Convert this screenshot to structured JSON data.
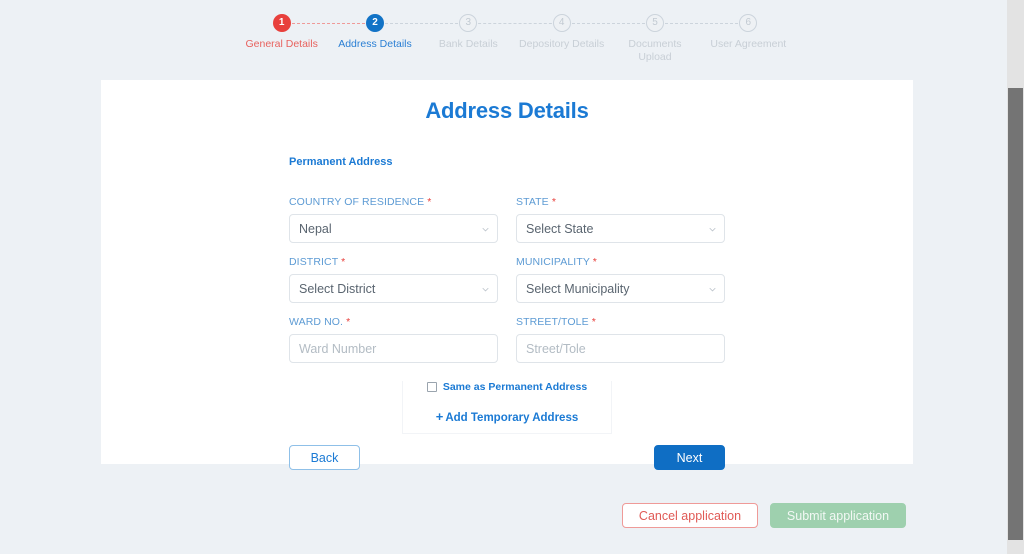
{
  "stepper": {
    "steps": [
      {
        "number": "1",
        "label": "General Details",
        "state": "done"
      },
      {
        "number": "2",
        "label": "Address Details",
        "state": "active"
      },
      {
        "number": "3",
        "label": "Bank Details",
        "state": "todo"
      },
      {
        "number": "4",
        "label": "Depository Details",
        "state": "todo"
      },
      {
        "number": "5",
        "label": "Documents Upload",
        "state": "todo"
      },
      {
        "number": "6",
        "label": "User Agreement",
        "state": "todo"
      }
    ]
  },
  "card": {
    "title": "Address Details",
    "section_title": "Permanent Address",
    "fields": {
      "country": {
        "label": "COUNTRY OF RESIDENCE",
        "required": "*",
        "value": "Nepal"
      },
      "state": {
        "label": "STATE",
        "required": "*",
        "value": "Select State"
      },
      "district": {
        "label": "DISTRICT",
        "required": "*",
        "value": "Select District"
      },
      "municipality": {
        "label": "MUNICIPALITY",
        "required": "*",
        "value": "Select Municipality"
      },
      "ward": {
        "label": "WARD NO.",
        "required": "*",
        "placeholder": "Ward Number",
        "value": "Ward Number"
      },
      "street": {
        "label": "STREET/TOLE",
        "required": "*",
        "placeholder": "Street/Tole",
        "value": "Street/Tole"
      }
    },
    "same_as_permanent_label": "Same as Permanent Address",
    "add_temporary_label": "Add Temporary Address",
    "add_temporary_plus": "+",
    "back_label": "Back",
    "next_label": "Next"
  },
  "actions": {
    "cancel_label": "Cancel application",
    "submit_label": "Submit application"
  },
  "colors": {
    "accent_blue": "#1b7ad4",
    "danger_red": "#e8403c",
    "success_green": "#9ed0ae",
    "page_bg": "#edf1f5"
  }
}
